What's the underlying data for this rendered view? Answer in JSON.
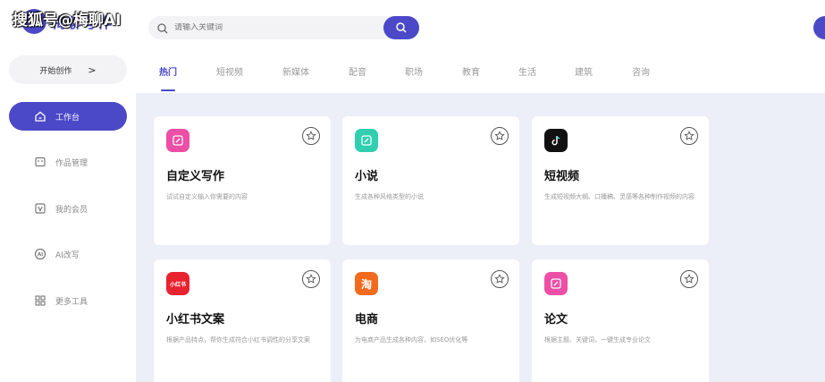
{
  "watermark": "搜狐号@梅聊AI",
  "logo": {
    "mark": "M",
    "text": "梅聊写作"
  },
  "sidebar": {
    "start_label": "开始创作",
    "start_chevron": ">",
    "items": [
      {
        "label": "工作台",
        "icon": "home-icon",
        "active": true
      },
      {
        "label": "作品管理",
        "icon": "folder-icon",
        "active": false
      },
      {
        "label": "我的会员",
        "icon": "vip-icon",
        "active": false
      },
      {
        "label": "AI改写",
        "icon": "ai-icon",
        "active": false
      },
      {
        "label": "更多工具",
        "icon": "grid-icon",
        "active": false
      }
    ]
  },
  "search": {
    "placeholder": "请输入关键词"
  },
  "tabs": [
    "热门",
    "短视频",
    "新媒体",
    "配音",
    "职场",
    "教育",
    "生活",
    "建筑",
    "咨询"
  ],
  "cards": [
    {
      "title": "自定义写作",
      "desc": "试试自定义输入你需要的内容",
      "icon_color": "#ec4fa6",
      "icon": "edit-icon",
      "icon_text": ""
    },
    {
      "title": "小说",
      "desc": "生成各种风格类型的小说",
      "icon_color": "#2fcfb0",
      "icon": "edit-icon",
      "icon_text": ""
    },
    {
      "title": "短视频",
      "desc": "生成短视频大纲、口播稿、灵感等各种制作视频的内容",
      "icon_color": "#111111",
      "icon": "tiktok-icon",
      "icon_text": ""
    },
    {
      "title": "小红书文案",
      "desc": "根据产品特点，帮你生成符合小红书调性的分享文案",
      "icon_color": "#e8232f",
      "icon": "xiaohongshu-icon",
      "icon_text": "小红书"
    },
    {
      "title": "电商",
      "desc": "为电商产品生成各种内容，如SEO优化等",
      "icon_color": "#f26b1d",
      "icon": "taobao-icon",
      "icon_text": "淘"
    },
    {
      "title": "论文",
      "desc": "根据主题、关键词，一键生成专业论文",
      "icon_color": "#ec4fa6",
      "icon": "edit-icon",
      "icon_text": ""
    }
  ]
}
